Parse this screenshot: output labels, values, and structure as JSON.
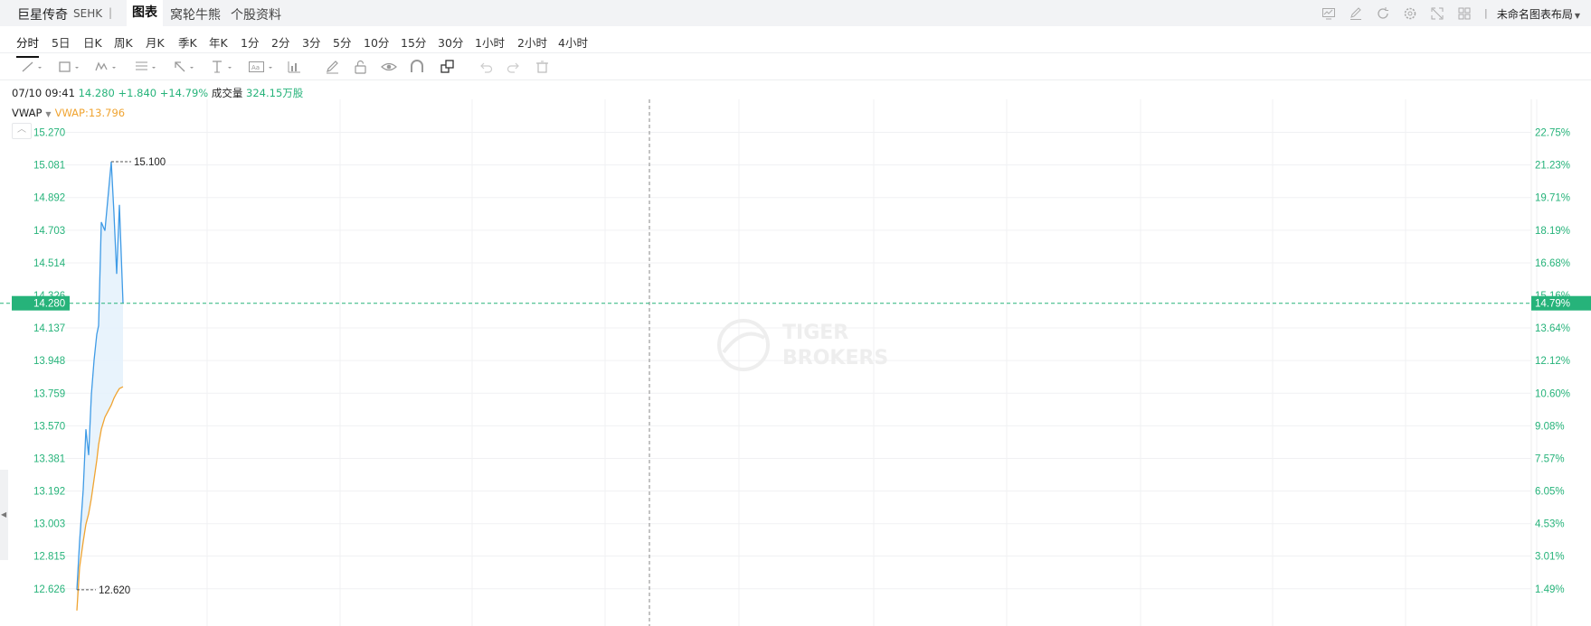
{
  "header": {
    "stock_name": "巨星传奇",
    "exchange": "SEHK",
    "separator": "|",
    "tabs": [
      {
        "label": "图表",
        "active": true
      },
      {
        "label": "窝轮牛熊",
        "active": false
      },
      {
        "label": "个股资料",
        "active": false
      }
    ],
    "toolbar_icons": [
      "compare-icon",
      "edit-icon",
      "refresh-icon",
      "settings-icon",
      "fullscreen-icon",
      "grid-layout-icon"
    ],
    "layout_name": "未命名图表布局"
  },
  "intervals": [
    "分时",
    "5日",
    "日K",
    "周K",
    "月K",
    "季K",
    "年K",
    "1分",
    "2分",
    "3分",
    "5分",
    "10分",
    "15分",
    "30分",
    "1小时",
    "2小时",
    "4小时"
  ],
  "active_interval": "分时",
  "drawing_tools": [
    "trend-line-icon",
    "rectangle-icon",
    "pattern-icon",
    "fib-icon",
    "arrow-icon",
    "text-cursor-icon",
    "text-label-icon",
    "indicator-icon",
    "pencil-icon",
    "lock-icon",
    "eye-icon",
    "magnet-icon",
    "layers-icon",
    "undo-icon",
    "redo-icon",
    "trash-icon"
  ],
  "quote": {
    "datetime": "07/10 09:41",
    "price": "14.280",
    "change": "+1.840",
    "change_pct": "+14.79%",
    "volume_label": "成交量",
    "volume": "324.15万股"
  },
  "indicator": {
    "name": "VWAP",
    "value_text": "VWAP:13.796"
  },
  "colors": {
    "up": "#26b37a",
    "price_line": "#3f9be6",
    "vwap_line": "#f0a431",
    "area_fill": "#e4f1fc",
    "crosshair": "#888888"
  },
  "watermark": "TIGER BROKERS",
  "chart_data": {
    "type": "line",
    "left_axis_ticks": [
      "15.270",
      "15.081",
      "14.892",
      "14.703",
      "14.514",
      "14.137",
      "13.948",
      "13.759",
      "13.570",
      "13.381",
      "13.192",
      "13.003",
      "12.815",
      "12.626"
    ],
    "right_axis_ticks": [
      "22.75%",
      "21.23%",
      "19.71%",
      "18.19%",
      "16.68%",
      "13.64%",
      "12.12%",
      "10.60%",
      "9.08%",
      "7.57%",
      "6.05%",
      "4.53%",
      "3.01%",
      "1.49%"
    ],
    "left_axis_hidden_tick": "14.326",
    "right_axis_hidden_tick": "15.16%",
    "ylim": [
      12.53,
      15.33
    ],
    "current_price": "14.280",
    "current_pct": "14.79%",
    "current_value": 14.28,
    "high_label": "15.100",
    "high": 15.1,
    "low_label": "12.620",
    "low": 12.62,
    "grid": true,
    "x_session_minutes": 330,
    "series": [
      {
        "name": "",
        "style": "price",
        "values": [
          12.62,
          12.9,
          13.2,
          13.55,
          13.4,
          13.75,
          13.95,
          14.1,
          14.15,
          14.75,
          14.7,
          15.1,
          14.8,
          14.45,
          14.85,
          14.28
        ]
      },
      {
        "name": "VWAP",
        "style": "vwap",
        "values": [
          12.5,
          12.75,
          12.9,
          13.0,
          13.06,
          13.15,
          13.26,
          13.37,
          13.46,
          13.55,
          13.62,
          13.69,
          13.73,
          13.76,
          13.786,
          13.796
        ]
      }
    ]
  }
}
